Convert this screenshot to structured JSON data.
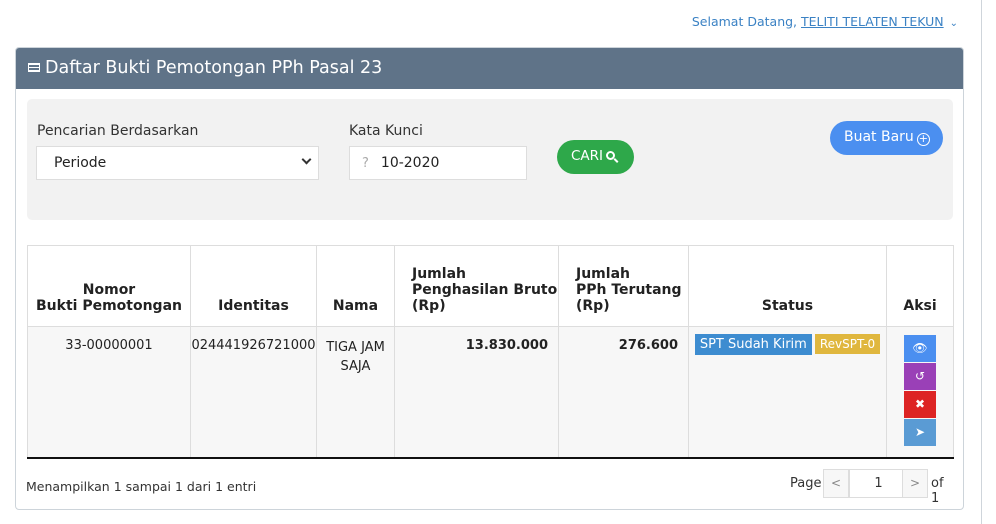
{
  "header": {
    "greeting": "Selamat Datang, ",
    "user": "TELITI TELATEN TEKUN",
    "caret": "⌄"
  },
  "panel": {
    "title": "Daftar Bukti Pemotongan PPh Pasal 23"
  },
  "search": {
    "by_label": "Pencarian Berdasarkan",
    "by_value": "Periode",
    "keyword_label": "Kata Kunci",
    "keyword_icon": "?",
    "keyword_value": "10-2020",
    "search_button": "CARI",
    "new_button": "Buat Baru"
  },
  "table": {
    "headers": {
      "nomor_1": "Nomor",
      "nomor_2": "Bukti Pemotongan",
      "identitas": "Identitas",
      "nama": "Nama",
      "bruto_1": "Jumlah",
      "bruto_2": "Penghasilan Bruto",
      "bruto_3": "(Rp)",
      "pph_1": "Jumlah",
      "pph_2": "PPh Terutang",
      "pph_3": "(Rp)",
      "status": "Status",
      "aksi": "Aksi"
    },
    "rows": [
      {
        "nomor": "33-00000001",
        "identitas": "024441926721000",
        "nama": "TIGA JAM SAJA",
        "bruto": "13.830.000",
        "pph": "276.600",
        "status_sent": "SPT Sudah Kirim",
        "status_rev": "RevSPT-0"
      }
    ]
  },
  "footer": {
    "info": "Menampilkan 1 sampai 1 dari 1 entri",
    "page_label": "Page",
    "prev": "<",
    "current_page": "1",
    "next": ">",
    "of_label": "of 1"
  },
  "colors": {
    "panel_header": "#5f7388",
    "cari_button": "#2ea84a",
    "buat_baru_button": "#4b8ff0",
    "badge_sent": "#3d8cd0",
    "badge_rev": "#e0b73e",
    "action_view": "#4b8ff0",
    "action_undo": "#9a40b7",
    "action_delete": "#dd2424",
    "action_send": "#5a9bd4"
  },
  "icons": {
    "view": "eye-icon",
    "undo": "undo-icon",
    "delete": "times-icon",
    "send": "paper-plane-icon",
    "search": "search-icon",
    "add": "plus-circle-icon",
    "list": "list-icon"
  }
}
